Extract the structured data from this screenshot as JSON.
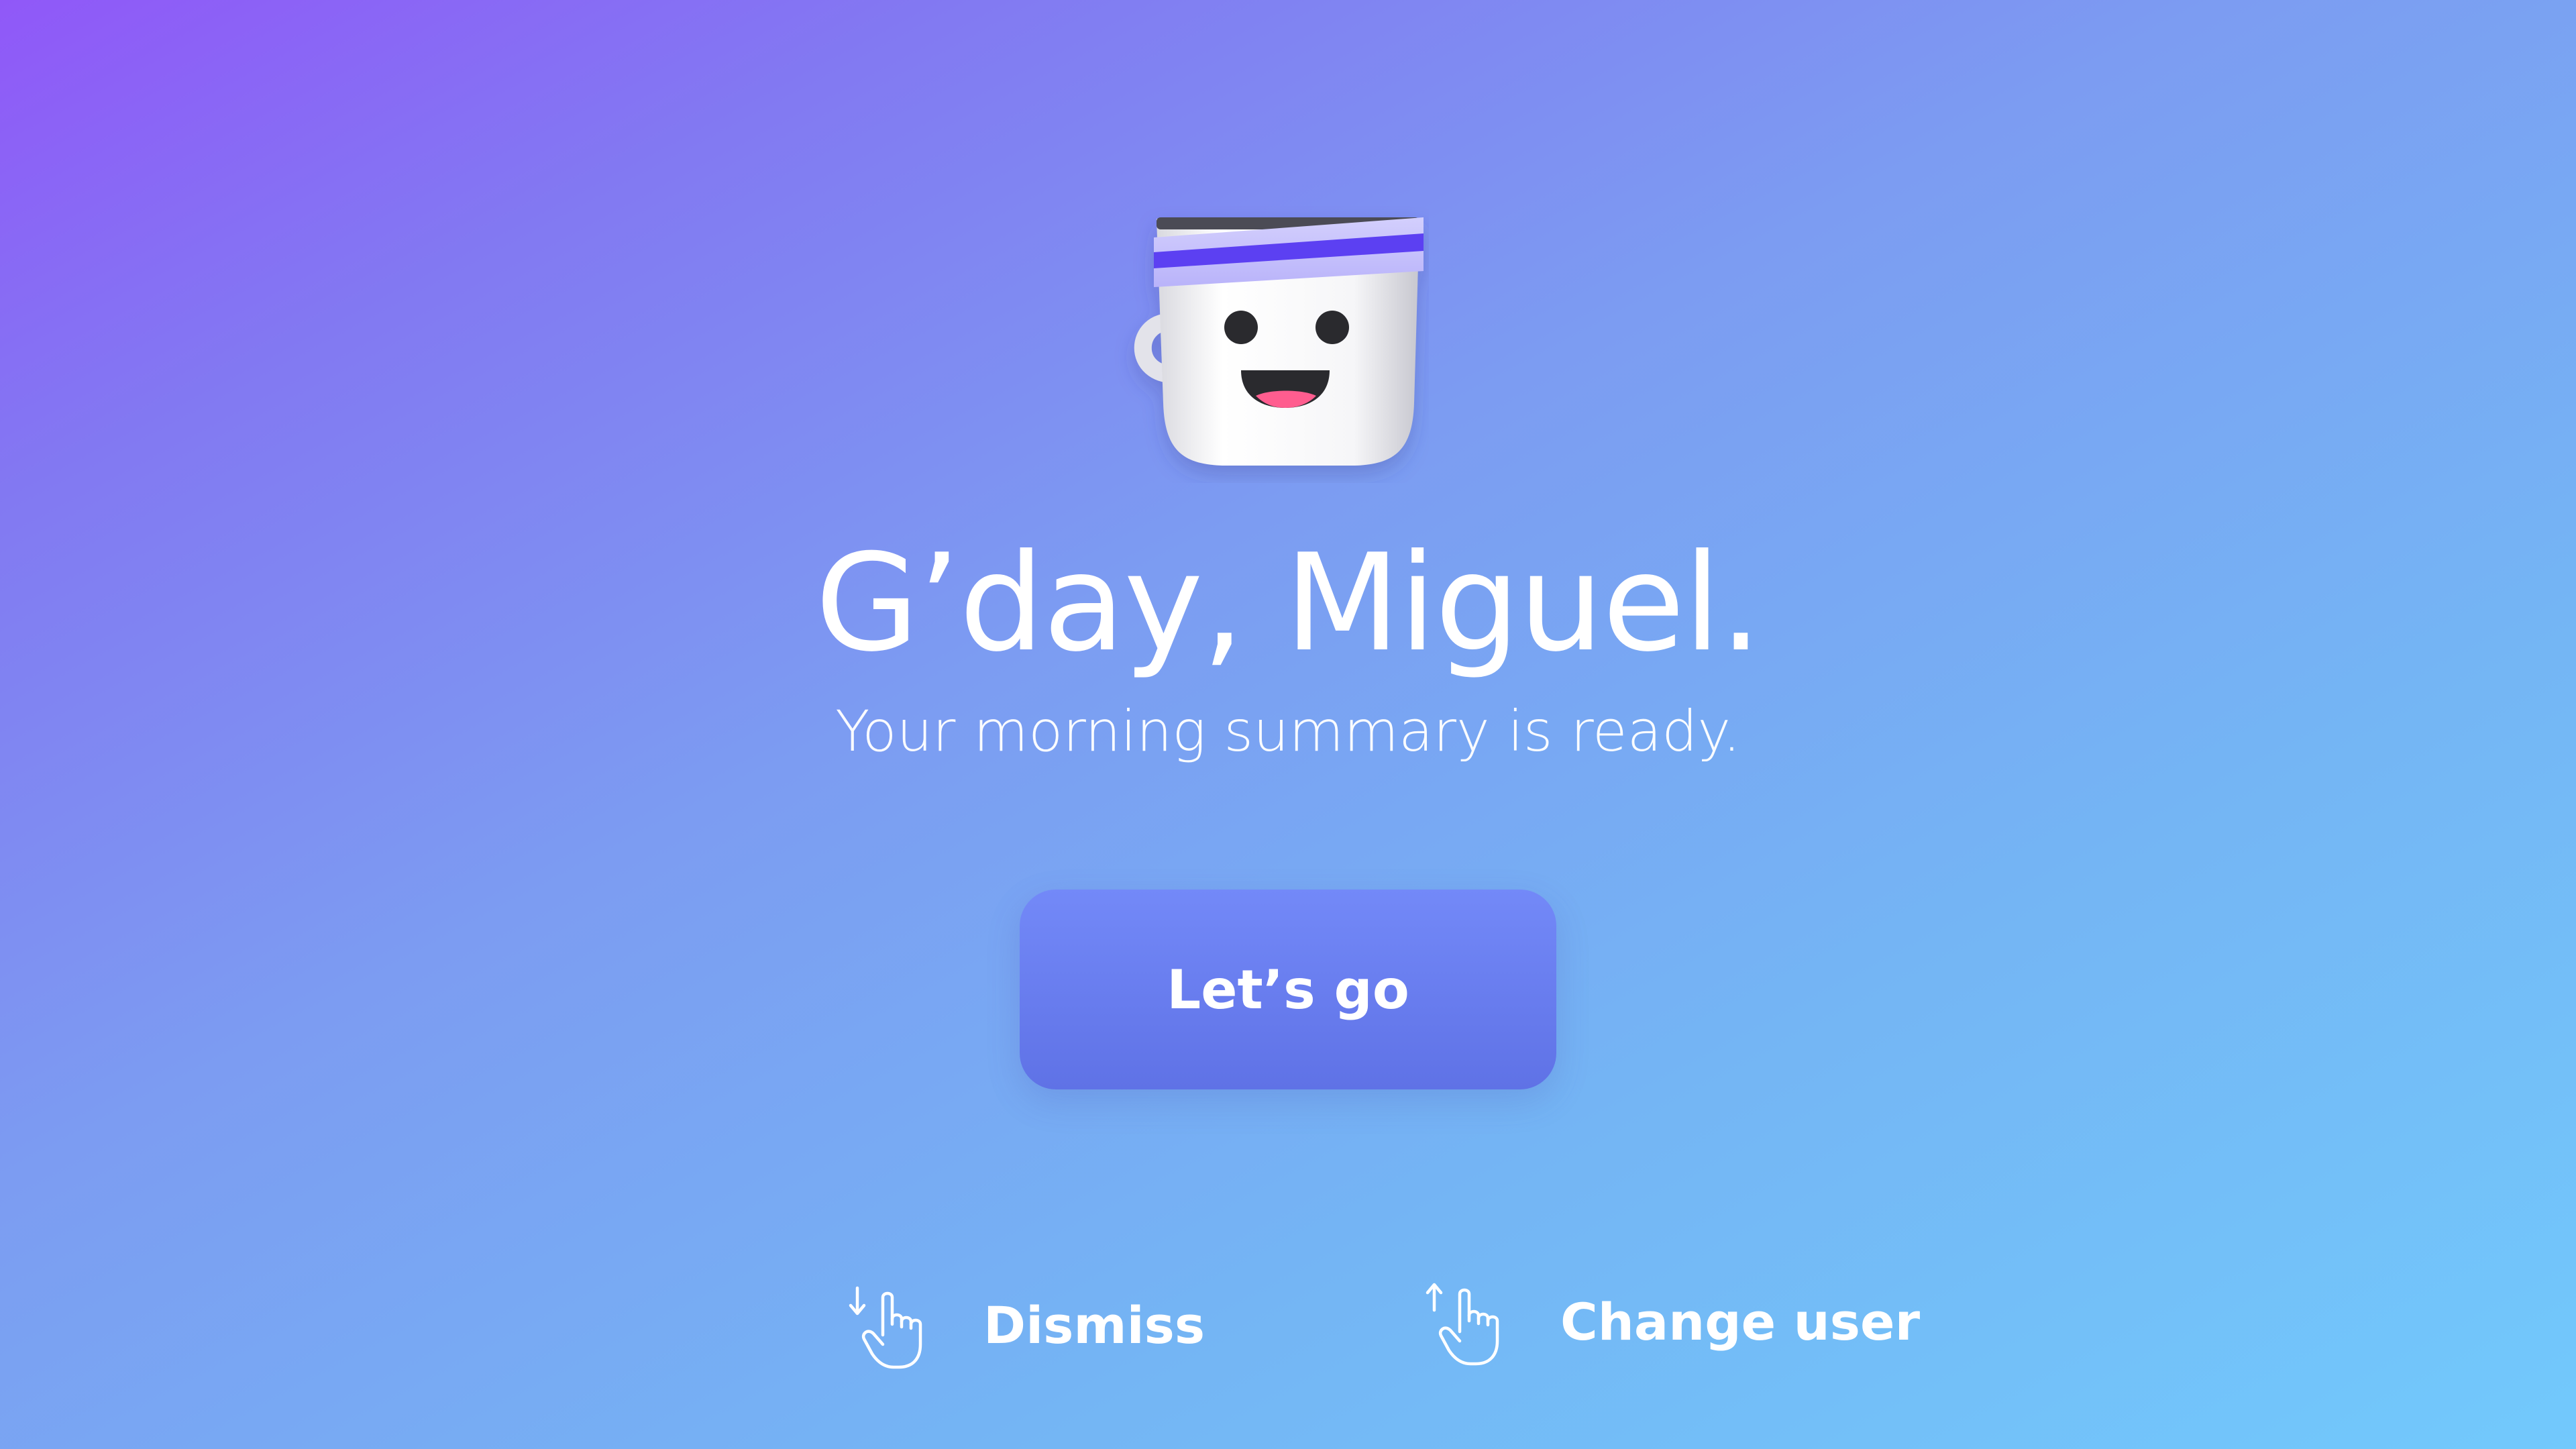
{
  "greeting": {
    "title": "G’day, Miguel.",
    "subtitle": "Your morning summary is ready."
  },
  "mascot": {
    "icon": "smiling-coffee-cup-icon",
    "headband_color": "#5b3ff2"
  },
  "primary_action": {
    "label": "Let’s go",
    "color": "#6a7df0"
  },
  "gestures": [
    {
      "icon": "swipe-down-hand-icon",
      "label": "Dismiss"
    },
    {
      "icon": "swipe-up-hand-icon",
      "label": "Change user"
    }
  ],
  "colors": {
    "background_start": "#9058f8",
    "background_end": "#72c9fc",
    "text": "#ffffff"
  }
}
